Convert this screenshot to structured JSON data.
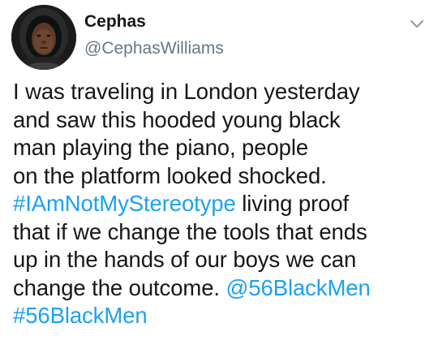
{
  "user": {
    "display_name": "Cephas",
    "handle": "@CephasWilliams",
    "avatar_icon": "profile-photo"
  },
  "menu": {
    "icon": "chevron-down-icon"
  },
  "tweet": {
    "line1": "I was traveling in London yesterday",
    "line2": "and saw this hooded young black",
    "line3": "man playing the piano, people",
    "line4": "on the platform looked shocked.",
    "hashtag1": "#IAmNotMyStereotype",
    "line5_rest": " living proof",
    "line6": "that if we change the tools that ends",
    "line7": "up in the hands of our boys we can",
    "line8_pre": "change the outcome. ",
    "mention": "@56BlackMen",
    "hashtag2": "#56BlackMen"
  },
  "colors": {
    "text": "#14171a",
    "secondary": "#657786",
    "link": "#1da1f2"
  }
}
